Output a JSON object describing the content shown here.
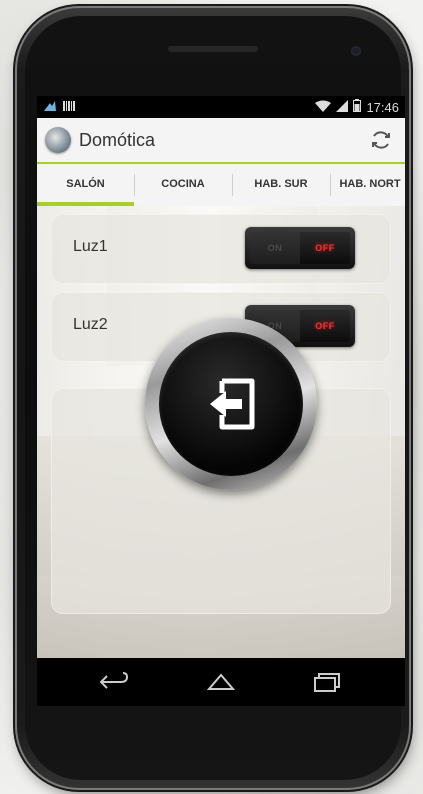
{
  "status_bar": {
    "time": "17:46",
    "icons": [
      "notification-icon",
      "barcode-icon",
      "wifi-icon",
      "signal-icon",
      "battery-icon"
    ]
  },
  "action_bar": {
    "title": "Domótica",
    "logo_icon": "app-logo-icon",
    "refresh_icon": "refresh-icon"
  },
  "tabs": [
    {
      "label": "SALÓN",
      "active": true
    },
    {
      "label": "COCINA",
      "active": false
    },
    {
      "label": "HAB. SUR",
      "active": false
    },
    {
      "label": "HAB. NORT",
      "active": false
    }
  ],
  "lights": [
    {
      "label": "Luz1",
      "on_label": "ON",
      "off_label": "OFF",
      "state": "off"
    },
    {
      "label": "Luz2",
      "on_label": "ON",
      "off_label": "OFF",
      "state": "off"
    }
  ],
  "exit_button": {
    "icon": "exit-icon"
  },
  "nav_bar": {
    "icons": [
      "back-icon",
      "home-icon",
      "recents-icon"
    ]
  },
  "colors": {
    "accent": "#a7cf2a",
    "off_red": "#ff2e2e",
    "status_bar": "#000000"
  }
}
